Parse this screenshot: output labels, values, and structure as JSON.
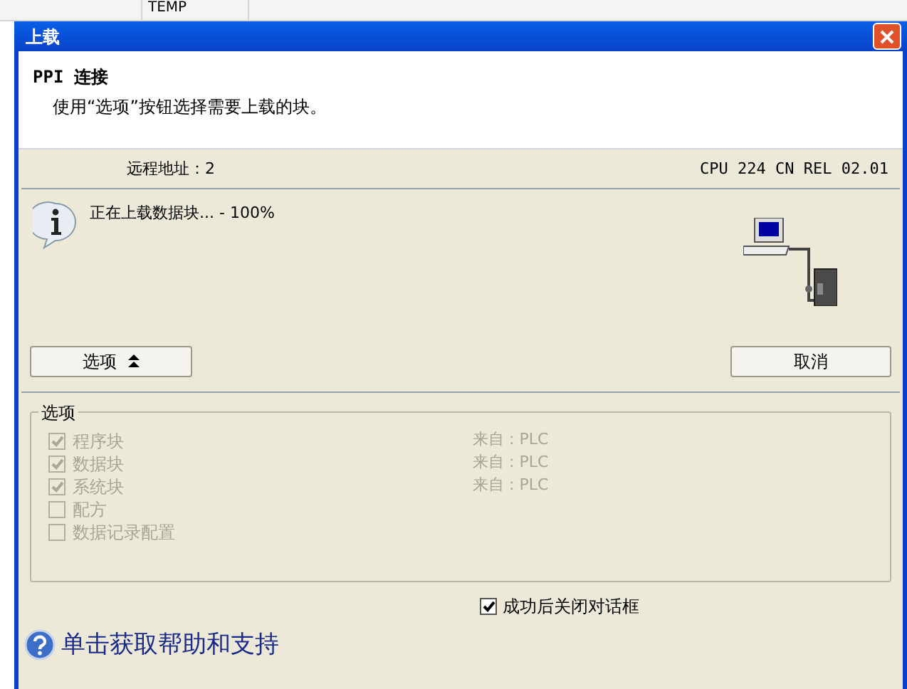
{
  "background": {
    "column_header": "TEMP"
  },
  "window": {
    "title": "上载"
  },
  "header": {
    "title": "PPI 连接",
    "subtitle": "使用“选项”按钮选择需要上载的块。"
  },
  "connection": {
    "remote_address": "远程地址：2",
    "cpu": "CPU 224 CN REL 02.01"
  },
  "status": {
    "message": "正在上载数据块... - 100%"
  },
  "buttons": [
    {
      "label": "选项",
      "kind": "options"
    },
    {
      "label": "取消",
      "kind": "cancel"
    }
  ],
  "options": {
    "title": "选项",
    "disabled": true,
    "items": [
      {
        "label": "程序块",
        "checked": true,
        "source": "来自 : PLC"
      },
      {
        "label": "数据块",
        "checked": true,
        "source": "来自 : PLC"
      },
      {
        "label": "系统块",
        "checked": true,
        "source": "来自 : PLC"
      },
      {
        "label": "配方",
        "checked": false
      },
      {
        "label": "数据记录配置",
        "checked": false
      }
    ]
  },
  "close_on_success": {
    "label": "成功后关闭对话框",
    "checked": true
  },
  "help_link": "单击获取帮助和支持"
}
